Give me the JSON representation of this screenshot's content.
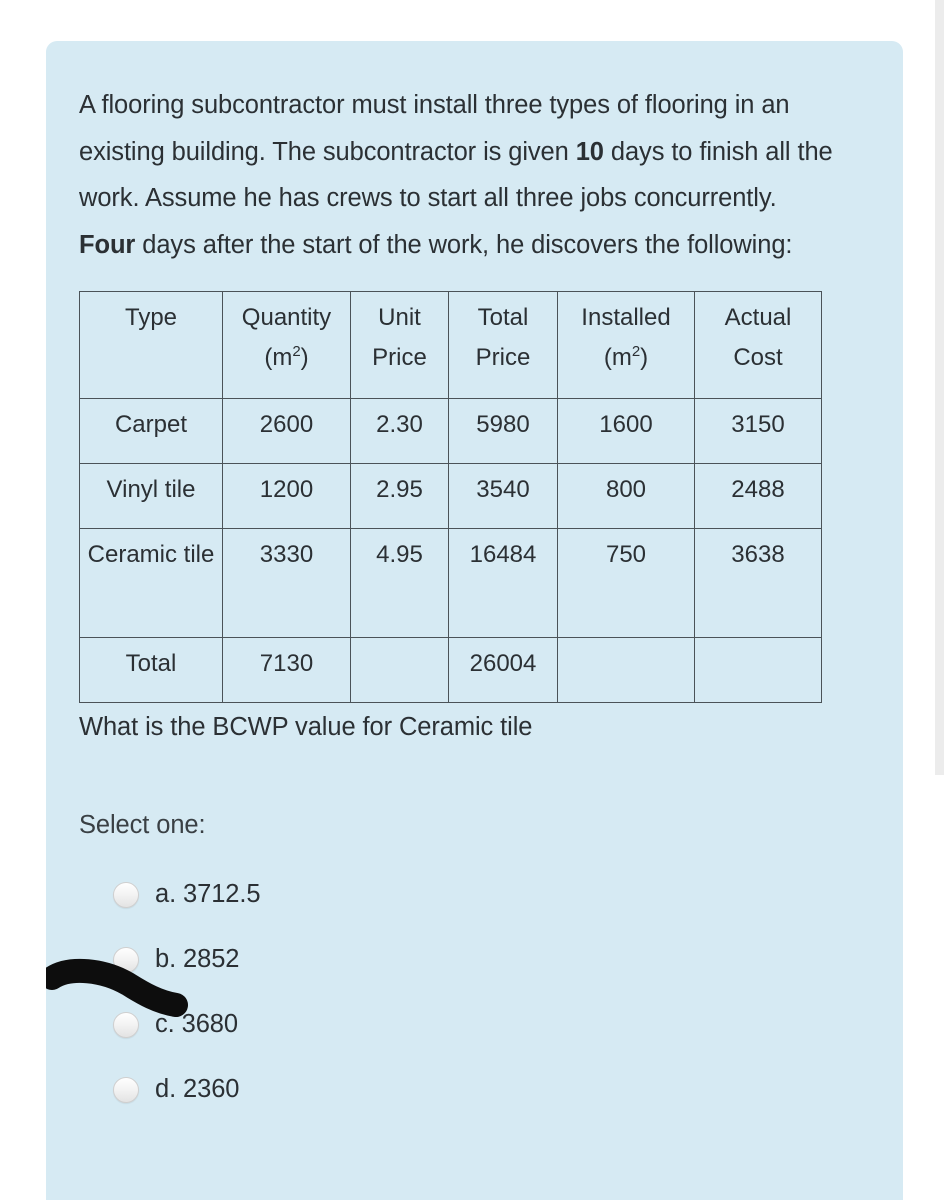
{
  "question": {
    "statement_parts": [
      {
        "text": "A flooring subcontractor must install three types of flooring in an existing building. The subcontractor is given ",
        "bold": false
      },
      {
        "text": "10",
        "bold": true
      },
      {
        "text": " days to finish all the work. Assume he has crews to start all three jobs concurrently. ",
        "bold": false
      },
      {
        "text": "Four",
        "bold": true
      },
      {
        "text": " days after the start of the work, he discovers the following:",
        "bold": false
      }
    ],
    "prompt": "What is the BCWP value for Ceramic tile",
    "select_instruction": "Select one:"
  },
  "table": {
    "headers": [
      {
        "line1": "Type",
        "line2": "",
        "superscript": ""
      },
      {
        "line1": "Quantity",
        "line2": "(m",
        "superscript": "2",
        "line2_suffix": ")"
      },
      {
        "line1": "Unit",
        "line2": "Price",
        "superscript": ""
      },
      {
        "line1": "Total",
        "line2": "Price",
        "superscript": ""
      },
      {
        "line1": "Installed",
        "line2": "(m",
        "superscript": "2",
        "line2_suffix": ")"
      },
      {
        "line1": "Actual",
        "line2": "Cost",
        "superscript": ""
      }
    ],
    "rows": [
      {
        "type": "Carpet",
        "quantity": "2600",
        "unit_price": "2.30",
        "total_price": "5980",
        "installed": "1600",
        "actual_cost": "3150"
      },
      {
        "type": "Vinyl tile",
        "quantity": "1200",
        "unit_price": "2.95",
        "total_price": "3540",
        "installed": "800",
        "actual_cost": "2488"
      },
      {
        "type": "Ceramic tile",
        "quantity": "3330",
        "unit_price": "4.95",
        "total_price": "16484",
        "installed": "750",
        "actual_cost": "3638"
      }
    ],
    "total_row": {
      "type": "Total",
      "quantity": "7130",
      "unit_price": "",
      "total_price": "26004",
      "installed": "",
      "actual_cost": ""
    }
  },
  "answers": [
    {
      "label": "a. 3712.5",
      "marked": true
    },
    {
      "label": "b. 2852",
      "marked": false
    },
    {
      "label": "c. 3680",
      "marked": false
    },
    {
      "label": "d. 2360",
      "marked": false
    }
  ],
  "colors": {
    "card_background": "#d6eaf3",
    "page_background": "#ffffff",
    "text": "#2b3034",
    "table_border": "#4b5358",
    "marker": "#0d0d0d",
    "scrollbar_thumb": "#ececec"
  }
}
